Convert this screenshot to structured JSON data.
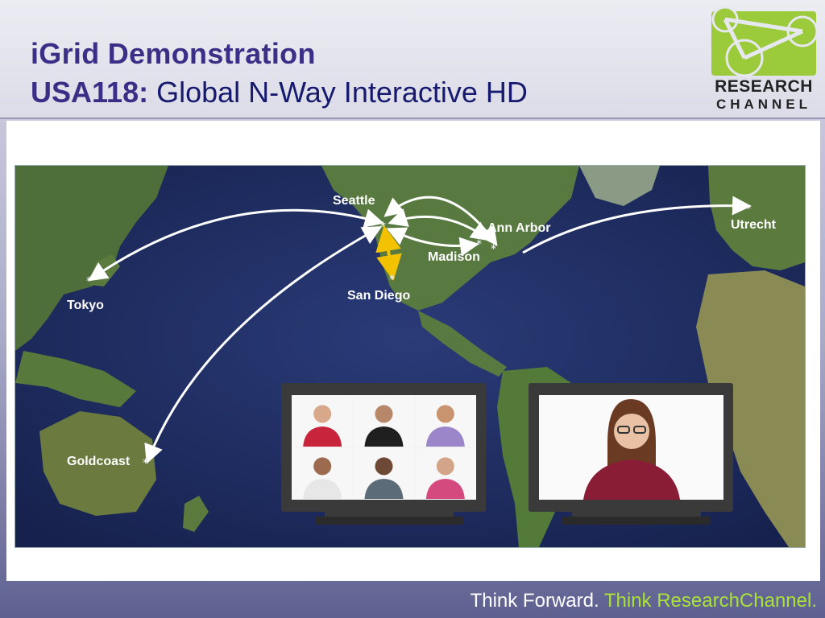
{
  "header": {
    "title_line1": "iGrid Demonstration",
    "title_line2_bold": "USA118:",
    "title_line2_rest": "Global N-Way Interactive HD"
  },
  "logo": {
    "word1": "RESEARCH",
    "word2": "CHANNEL",
    "color": "#9bcb3b"
  },
  "map": {
    "cities": {
      "seattle": "Seattle",
      "ann_arbor": "Ann Arbor",
      "madison": "Madison",
      "san_diego": "San Diego",
      "utrecht": "Utrecht",
      "tokyo": "Tokyo",
      "goldcoast": "Goldcoast"
    },
    "colors": {
      "ocean": "#1d2a5c",
      "land": "#4f6f3a",
      "arrow": "#ffffff",
      "highlight_arrow": "#f2c200"
    }
  },
  "screens": {
    "left_grid_people": 6,
    "right_single_person": 1,
    "icon": "hd-display-icon"
  },
  "footer": {
    "part1": "Think Forward.",
    "part2": "Think ResearchChannel.",
    "accent_color": "#a9e23a"
  }
}
